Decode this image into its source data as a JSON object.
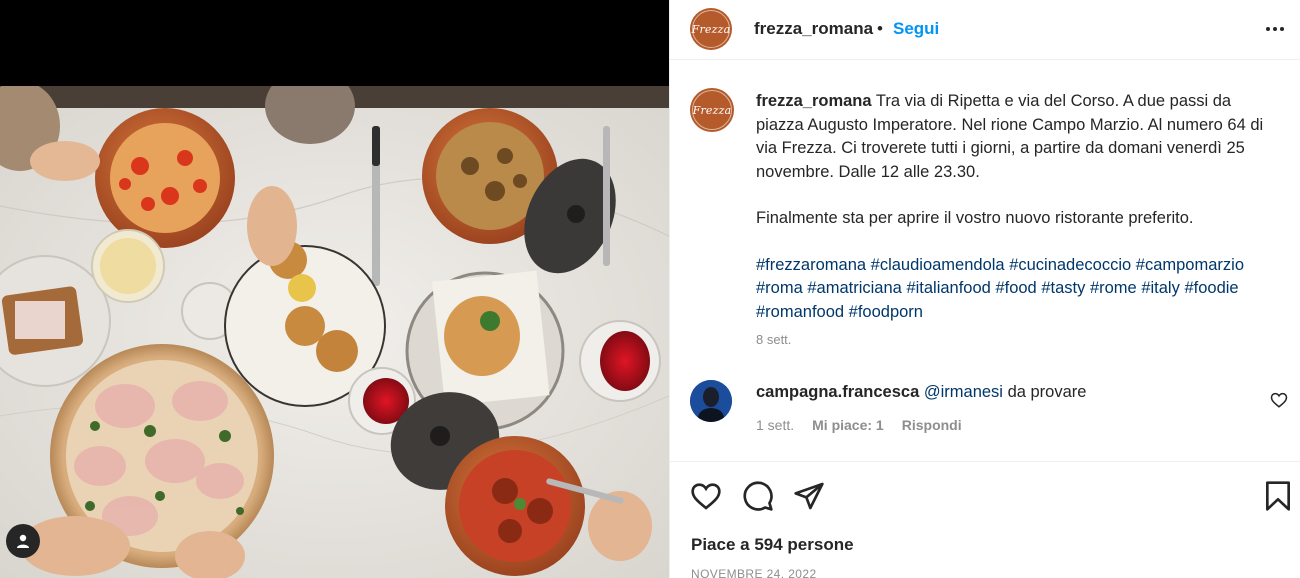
{
  "post": {
    "username": "frezza_romana",
    "separator": "•",
    "follow_label": "Segui",
    "avatar_logo": "Frezza",
    "brand_color": "#b55a2a",
    "link_color": "#00376b",
    "follow_color": "#0095f6"
  },
  "caption": {
    "username": "frezza_romana",
    "text": "Tra via di Ripetta e via del Corso. A due passi da piazza Augusto Imperatore. Nel rione Campo Marzio. Al numero 64 di via Frezza. Ci troverete tutti i giorni, a partire da domani venerdì 25 novembre. Dalle 12 alle 23.30.",
    "text2": "Finalmente sta per aprire il vostro nuovo ristorante preferito.",
    "hashtags": [
      "#frezzaromana",
      "#claudioamendola",
      "#cucinadecoccio",
      "#campomarzio",
      "#roma",
      "#amatriciana",
      "#italianfood",
      "#food",
      "#tasty",
      "#rome",
      "#italy",
      "#foodie",
      "#romanfood",
      "#foodporn"
    ],
    "time": "8 sett."
  },
  "comment": {
    "username": "campagna.francesca",
    "mention": "@irmanesi",
    "text": "da provare",
    "time": "1 sett.",
    "likes_label": "Mi piace: 1",
    "reply_label": "Rispondi"
  },
  "actions": {
    "icons": [
      "heart-icon",
      "comment-icon",
      "share-icon",
      "bookmark-icon"
    ],
    "likes_text": "Piace a 594 persone",
    "date": "NOVEMBRE 24, 2022"
  }
}
